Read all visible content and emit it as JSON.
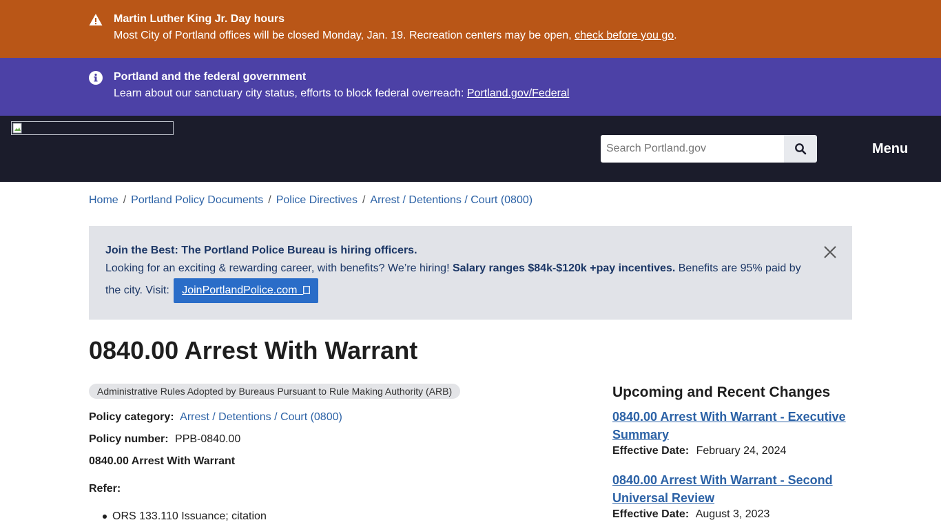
{
  "alerts": [
    {
      "title": "Martin Luther King Jr. Day hours",
      "text": "Most City of Portland offices will be closed Monday, Jan. 19. Recreation centers may be open, ",
      "link": "check before you go",
      "suffix": ".",
      "icon": "warning-icon",
      "color": "#b95617"
    },
    {
      "title": "Portland and the federal government",
      "text": "Learn about our sanctuary city status, efforts to block federal overreach: ",
      "link": "Portland.gov/Federal",
      "suffix": "",
      "icon": "info-icon",
      "color": "#4c41a6"
    }
  ],
  "header": {
    "search_placeholder": "Search Portland.gov",
    "search_icon": "search-icon",
    "menu_label": "Menu",
    "background": "#1b1c2b"
  },
  "breadcrumb": [
    "Home",
    "Portland Policy Documents",
    "Police Directives",
    "Arrest / Detentions / Court (0800)"
  ],
  "promo": {
    "title": "Join the Best: The Portland Police Bureau is hiring officers.",
    "text_before": "Looking for an exciting & rewarding career, with benefits? We’re hiring! ",
    "text_bold": "Salary ranges $84k-$120k +pay incentives.",
    "text_after": " Benefits are 95% paid by the city. Visit: ",
    "button_label": "JoinPortlandPolice.com",
    "button_icon": "external-link-icon",
    "close_icon": "close-icon"
  },
  "page": {
    "title": "0840.00 Arrest With Warrant",
    "tag": "Administrative Rules Adopted by Bureaus Pursuant to Rule Making Authority (ARB)",
    "policy_category_label": "Policy category:",
    "policy_category_value": "Arrest / Detentions / Court (0800)",
    "policy_number_label": "Policy number:",
    "policy_number_value": "PPB-0840.00",
    "subheading": "0840.00 Arrest With Warrant",
    "refer_label": "Refer:",
    "refer_items": [
      "ORS 133.110 Issuance; citation"
    ]
  },
  "sidebar": {
    "title": "Upcoming and Recent Changes",
    "changes": [
      {
        "link": "0840.00 Arrest With Warrant - Executive Summary",
        "date_label": "Effective Date:",
        "date": "February 24, 2024"
      },
      {
        "link": "0840.00 Arrest With Warrant - Second Universal Review",
        "date_label": "Effective Date:",
        "date": "August 3, 2023"
      }
    ]
  }
}
